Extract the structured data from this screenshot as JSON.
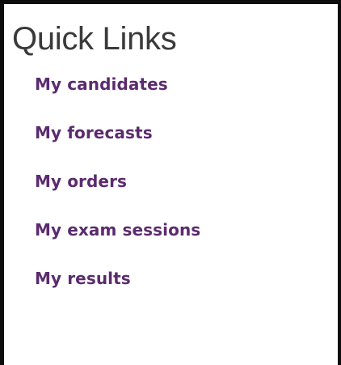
{
  "panel": {
    "title": "Quick Links",
    "links": [
      {
        "label": "My candidates"
      },
      {
        "label": "My forecasts"
      },
      {
        "label": "My orders"
      },
      {
        "label": "My exam sessions"
      },
      {
        "label": "My results"
      }
    ]
  },
  "colors": {
    "link": "#5b2b6e",
    "title": "#3a3a3a",
    "border": "#0d0d0d",
    "background": "#ffffff"
  }
}
